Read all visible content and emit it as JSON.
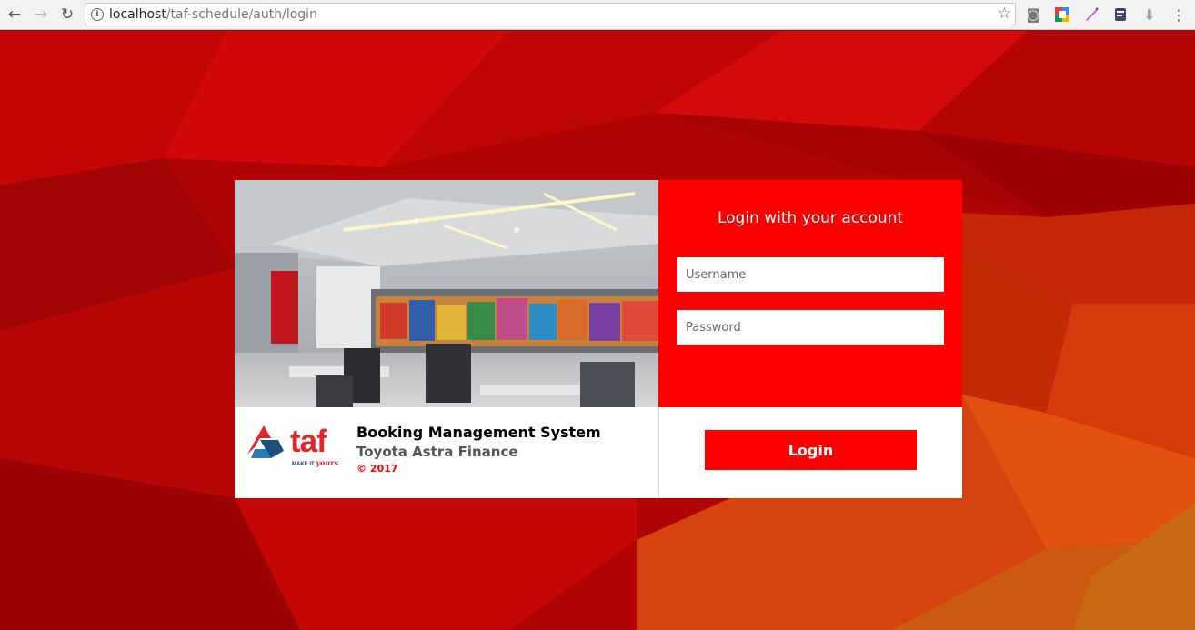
{
  "browser": {
    "url_host": "localhost",
    "url_path": "/taf-schedule/auth/login",
    "icons": [
      "back-arrow-icon",
      "forward-arrow-icon",
      "reload-icon",
      "info-icon",
      "star-icon",
      "camera-icon",
      "extension-icon",
      "pen-icon",
      "script-icon",
      "download-icon",
      "menu-icon"
    ],
    "glyphs": {
      "back": "←",
      "forward": "→",
      "reload": "↻",
      "info": "i",
      "star": "☆",
      "camera": "◙",
      "pen": "⁄",
      "download": "⬇",
      "menu": "⋮"
    }
  },
  "login": {
    "title": "Login with your account",
    "username_placeholder": "Username",
    "password_placeholder": "Password",
    "button_label": "Login"
  },
  "brand": {
    "logo_text": "taf",
    "tagline_prefix": "MAKE IT",
    "tagline_script": "yours"
  },
  "system": {
    "title": "Booking Management System",
    "company": "Toyota Astra Finance",
    "copyright": "© 2017"
  },
  "colors": {
    "accent": "#ff0000",
    "background": "#b00000"
  }
}
